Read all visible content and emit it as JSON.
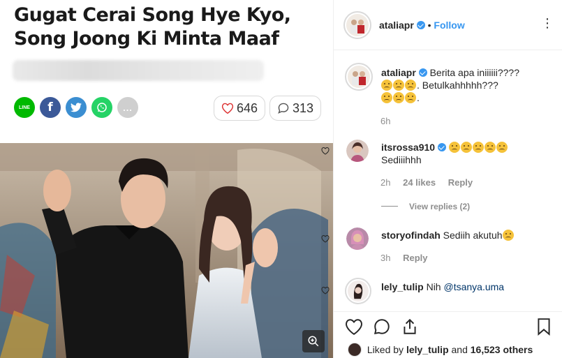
{
  "article": {
    "headline_line1": "Gugat Cerai Song Hye Kyo,",
    "headline_line2": "Song Joong Ki Minta Maaf",
    "share": [
      "LINE",
      "f",
      "t",
      "w",
      "..."
    ],
    "likes_count": "646",
    "comments_count": "313"
  },
  "post": {
    "author": "ataliapr",
    "follow_label": "Follow",
    "caption_line1": "Berita apa iniiiiii????",
    "caption_line2": ". Betulkahhhhh???",
    "caption_line3": ".",
    "caption_time": "6h"
  },
  "comments": [
    {
      "user": "itsrossa910",
      "text": "Sediiihhh",
      "time": "2h",
      "likes": "24 likes",
      "reply": "Reply"
    },
    {
      "user": "storyofindah",
      "text": "Sediih akutuh",
      "time": "3h",
      "reply": "Reply"
    },
    {
      "user": "lely_tulip",
      "text": "Nih ",
      "mention": "@tsanya.uma"
    }
  ],
  "view_replies": "View replies (2)",
  "liked_by": {
    "prefix": "Liked by ",
    "user": "lely_tulip",
    "mid": " and ",
    "others": "16,523 others"
  },
  "colors": {
    "accent": "#3897f0",
    "line": "#00b900",
    "facebook": "#3b5998",
    "twitter": "#3b8ed1",
    "whatsapp": "#25d366"
  }
}
